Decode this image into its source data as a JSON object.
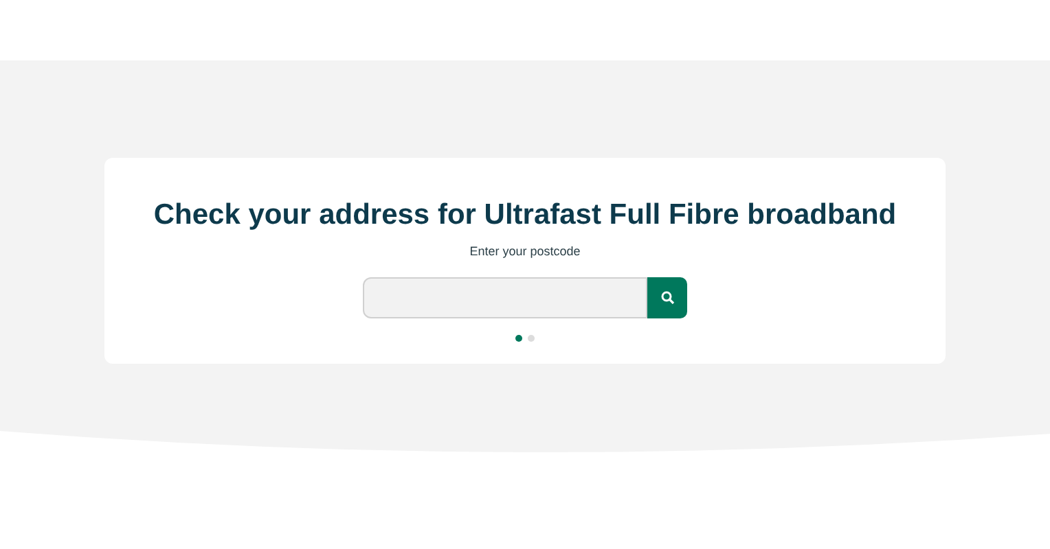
{
  "card": {
    "title": "Check your address for Ultrafast Full Fibre broadband",
    "label": "Enter your postcode",
    "pagination": [
      {
        "selected": true
      },
      {
        "selected": false
      }
    ]
  }
}
